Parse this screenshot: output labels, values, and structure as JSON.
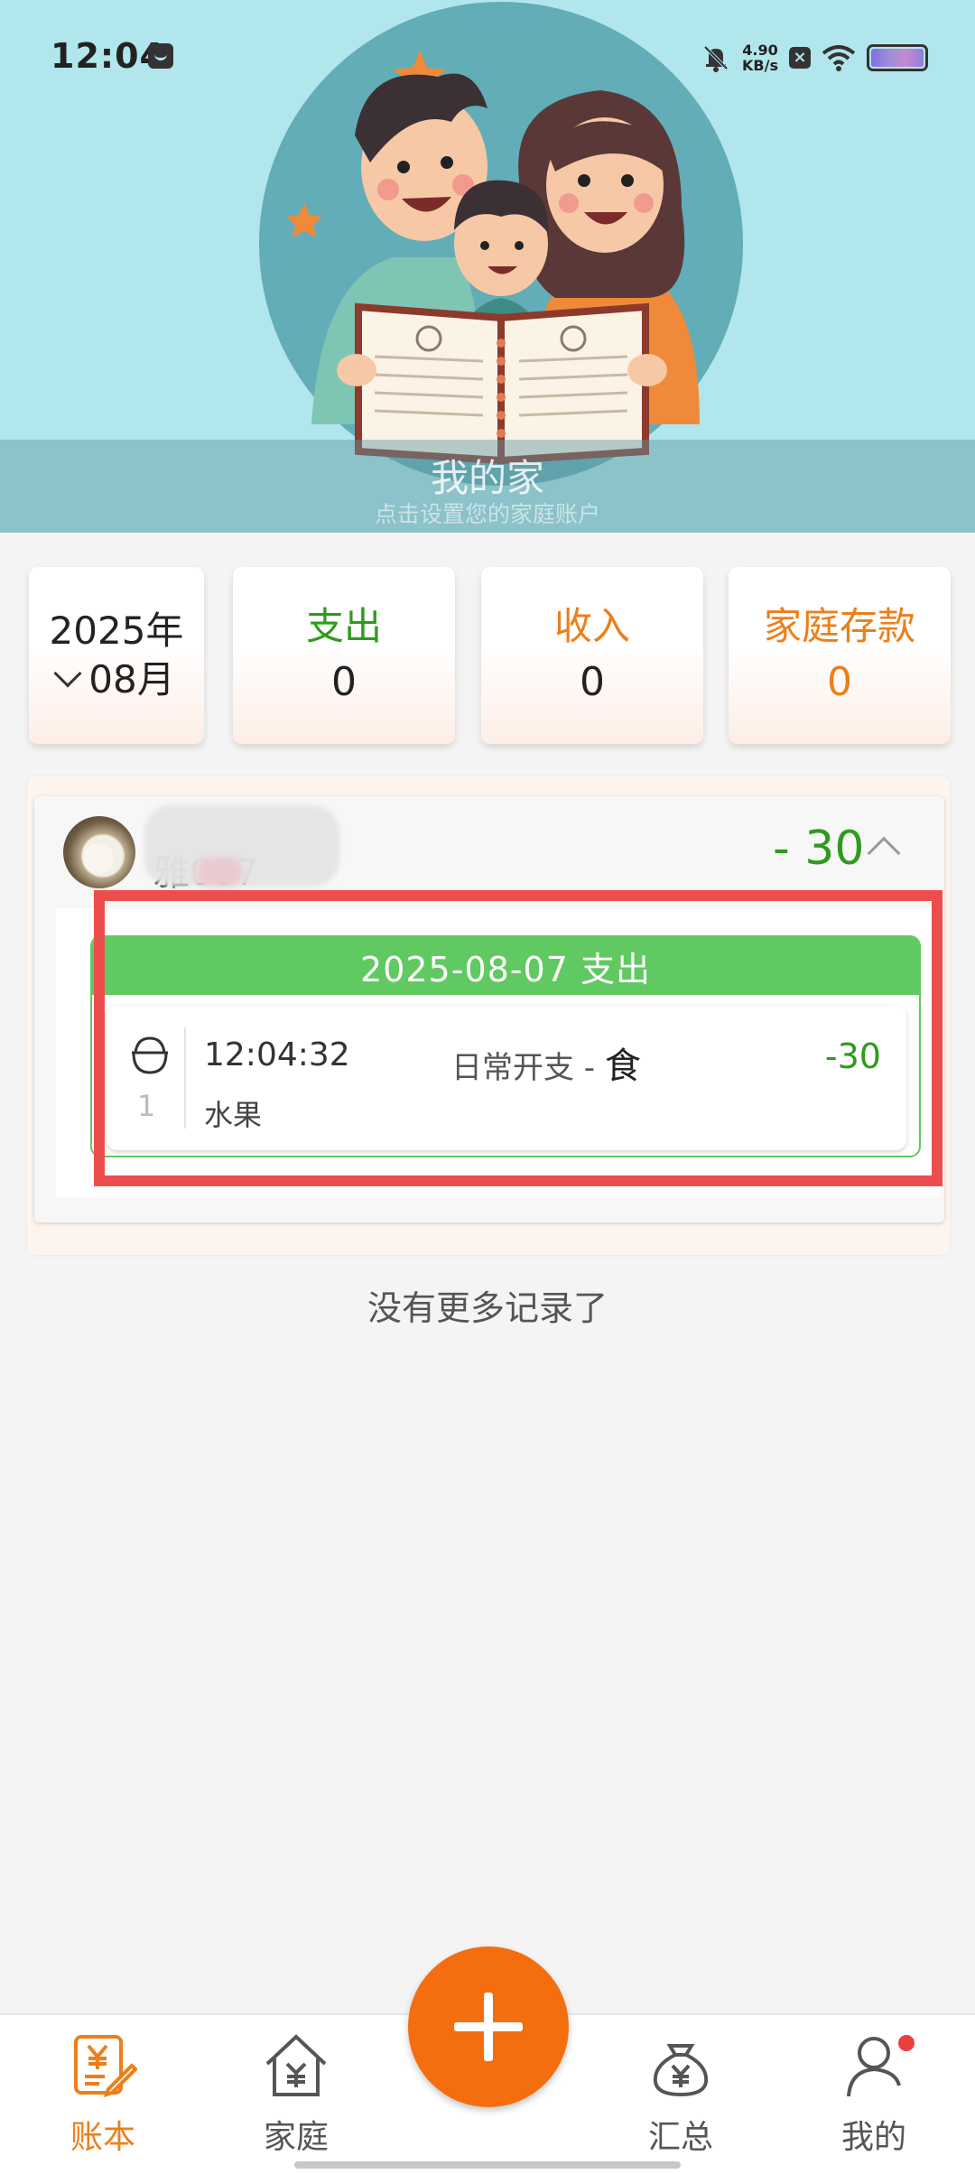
{
  "status_bar": {
    "time": "12:04",
    "net_speed_value": "4.90",
    "net_speed_unit": "KB/s",
    "icons": [
      "message-icon",
      "bell-mute-icon",
      "data-off-icon",
      "wifi-icon",
      "battery-icon"
    ]
  },
  "header": {
    "family_name": "我的家",
    "subtitle": "点击设置您的家庭账户"
  },
  "summary": {
    "year": "2025年",
    "month": "08月",
    "expense_label": "支出",
    "expense_value": "0",
    "income_label": "收入",
    "income_value": "0",
    "savings_label": "家庭存款",
    "savings_value": "0"
  },
  "record": {
    "user_name": "雅007",
    "total": "- 30",
    "groups": [
      {
        "header": "2025-08-07 支出",
        "items": [
          {
            "index": "1",
            "time": "12:04:32",
            "category": "日常开支 - ",
            "subcategory": "食",
            "amount": "-30",
            "note": "水果",
            "icon": "rice-bowl-icon"
          }
        ]
      }
    ]
  },
  "list_footer": "没有更多记录了",
  "nav": {
    "ledger": "账本",
    "family": "家庭",
    "summary": "汇总",
    "mine": "我的",
    "add_icon": "plus-icon"
  },
  "colors": {
    "accent": "#f46d0f",
    "expense_green": "#2f9b1e",
    "income_orange": "#ec7f1a",
    "header_bg": "#b1e6ec",
    "group_header_green": "#61c962",
    "highlight_red": "#ee4d4d"
  }
}
